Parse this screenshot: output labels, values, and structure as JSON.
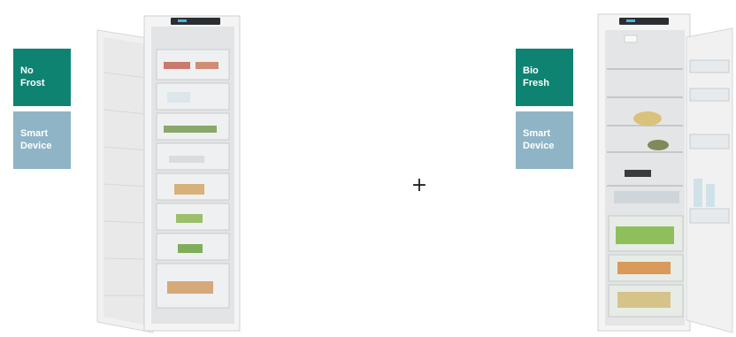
{
  "left_product": {
    "badges": [
      {
        "line1": "No",
        "line2": "Frost",
        "color": "#0f8372"
      },
      {
        "line1": "Smart",
        "line2": "Device",
        "color": "#8fb4c6"
      }
    ]
  },
  "right_product": {
    "badges": [
      {
        "line1": "Bio",
        "line2": "Fresh",
        "color": "#0f8372"
      },
      {
        "line1": "Smart",
        "line2": "Device",
        "color": "#8fb4c6"
      }
    ]
  },
  "combinator": "+"
}
